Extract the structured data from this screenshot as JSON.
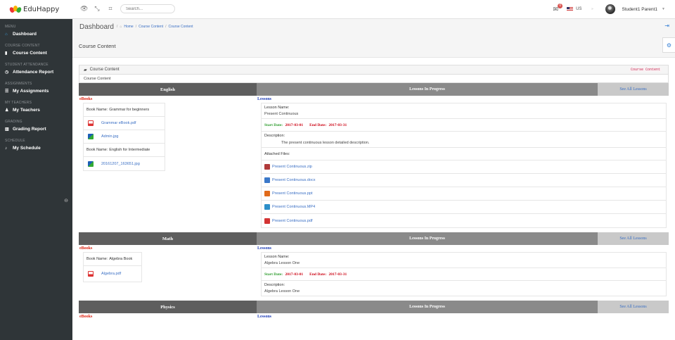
{
  "app": {
    "name": "EduHappy"
  },
  "header": {
    "search_placeholder": "Search...",
    "mail_count": "0",
    "language": "US",
    "user_name": "Student1 Parent1"
  },
  "sidebar": {
    "sections": [
      {
        "heading": "MENU",
        "item": "Dashboard",
        "icon": "home-icon"
      },
      {
        "heading": "COURSE CONTENT",
        "item": "Course Content",
        "icon": "book-icon"
      },
      {
        "heading": "STUDENT ATTENDANCE",
        "item": "Attendance Report",
        "icon": "clock-icon"
      },
      {
        "heading": "ASSIGNMENTS",
        "item": "My Assignments",
        "icon": "list-icon"
      },
      {
        "heading": "MY TEACHERS",
        "item": "My Teachers",
        "icon": "users-icon"
      },
      {
        "heading": "GRADING",
        "item": "Grading Report",
        "icon": "chart-icon"
      },
      {
        "heading": "SCHEDULE",
        "item": "My Schedule",
        "icon": "bell-icon"
      }
    ]
  },
  "breadcrumb": {
    "title": "Dashboard",
    "home": "Home",
    "parent": "Course Content",
    "current": "Course Content"
  },
  "page": {
    "title": "Course Content"
  },
  "panel": {
    "title": "Course Content",
    "badge": "Course Content",
    "subtitle": "Course Content"
  },
  "labels": {
    "lessons_in_progress": "Lessons In Progress",
    "see_all": "See All Lessons",
    "ebooks": "eBooks",
    "lessons": "Lessons",
    "book_name": "Book Name:",
    "lesson_name": "Lesson Name:",
    "start_date": "Start Date:",
    "end_date": "End Date:",
    "description": "Description:",
    "attached_files": "Attached Files:"
  },
  "subjects": [
    {
      "name": "English",
      "books": [
        {
          "name": "Grammar for beginners",
          "files": [
            {
              "name": "Grammar eBook.pdf",
              "type": "pdf"
            },
            {
              "name": "Admin.jpg",
              "type": "img"
            }
          ]
        },
        {
          "name": "English for Intermediate",
          "files": [
            {
              "name": "20161207_163651.jpg",
              "type": "img"
            }
          ]
        }
      ],
      "lesson": {
        "name": "Present Continuous",
        "start": "2017-03-01",
        "end": "2017-03-31",
        "description": "The present continuous lesson detailed description.",
        "files": [
          {
            "name": "Present Continuous.zip",
            "color": "#b03a3a"
          },
          {
            "name": "Present Continuous.docx",
            "color": "#3a78c9"
          },
          {
            "name": "Present Continuous.ppt",
            "color": "#e06a1a"
          },
          {
            "name": "Present Continuous.MP4",
            "color": "#2c8fc9"
          },
          {
            "name": "Present Continuous.pdf",
            "color": "#d33333"
          }
        ]
      }
    },
    {
      "name": "Math",
      "books": [
        {
          "name": "Algebra Book",
          "files": [
            {
              "name": "Algebra.pdf",
              "type": "pdf"
            }
          ]
        }
      ],
      "lesson": {
        "name": "Algebra Lesson One",
        "start": "2017-03-01",
        "end": "2017-03-31",
        "description": "Algebra Lesson One"
      }
    },
    {
      "name": "Physics"
    }
  ]
}
